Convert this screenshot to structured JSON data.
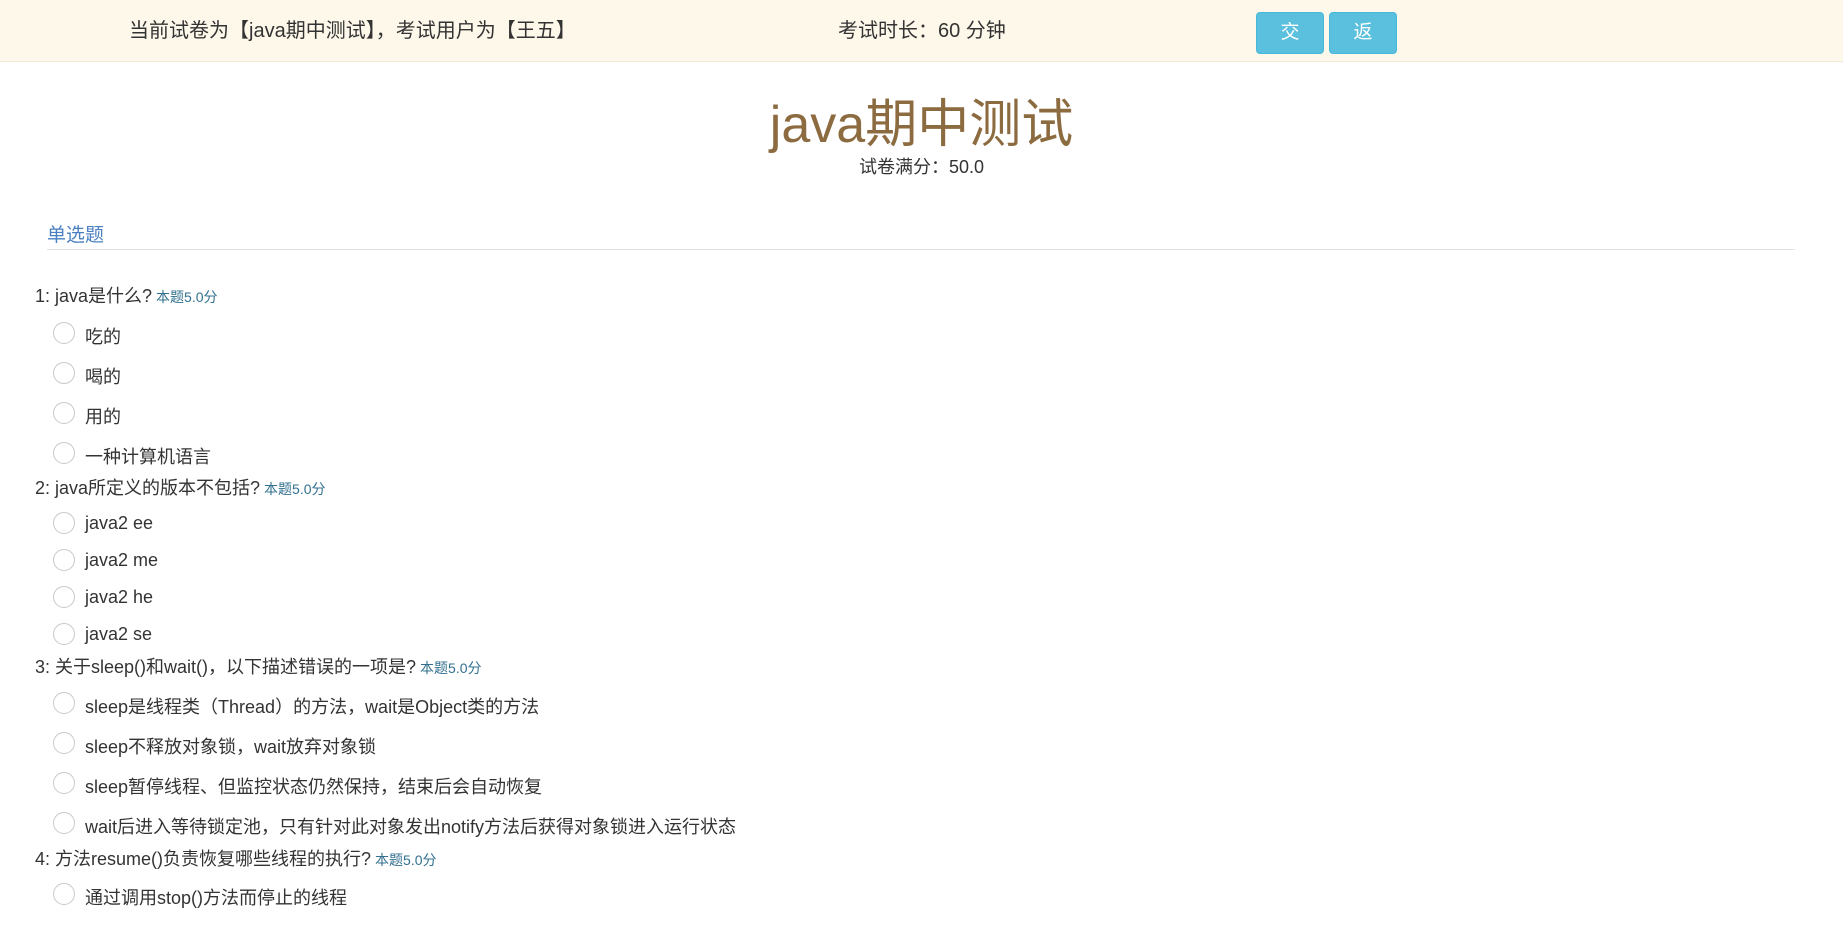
{
  "header": {
    "exam_info": "当前试卷为【java期中测试】，考试用户为【王五】",
    "duration": "考试时长：60 分钟",
    "submit_label": "交卷",
    "back_label": "返回"
  },
  "paper": {
    "title": "java期中测试",
    "full_score": "试卷满分：50.0"
  },
  "section": {
    "title": "单选题"
  },
  "questions": [
    {
      "text": "1: java是什么?",
      "points": "本题5.0分",
      "options": [
        "吃的",
        "喝的",
        "用的",
        "一种计算机语言"
      ]
    },
    {
      "text": "2: java所定义的版本不包括?",
      "points": "本题5.0分",
      "options": [
        "java2 ee",
        "java2 me",
        "java2 he",
        "java2 se"
      ]
    },
    {
      "text": "3: 关于sleep()和wait()，以下描述错误的一项是?",
      "points": "本题5.0分",
      "options": [
        "sleep是线程类（Thread）的方法，wait是Object类的方法",
        "sleep不释放对象锁，wait放弃对象锁",
        "sleep暂停线程、但监控状态仍然保持，结束后会自动恢复",
        "wait后进入等待锁定池，只有针对此对象发出notify方法后获得对象锁进入运行状态"
      ]
    },
    {
      "text": "4: 方法resume()负责恢复哪些线程的执行?",
      "points": "本题5.0分",
      "options": [
        "通过调用stop()方法而停止的线程"
      ]
    }
  ]
}
